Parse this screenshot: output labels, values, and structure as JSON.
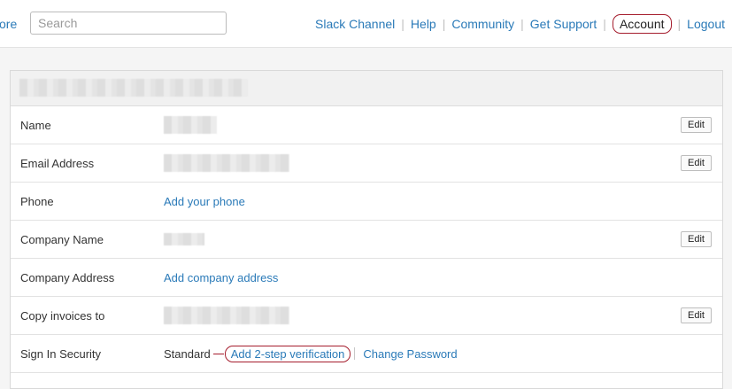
{
  "topbar": {
    "store_label": "ore",
    "search": {
      "placeholder": "Search",
      "value": ""
    },
    "nav": {
      "slack": "Slack Channel",
      "help": "Help",
      "community": "Community",
      "support": "Get Support",
      "account": "Account",
      "logout": "Logout"
    }
  },
  "profile": {
    "rows": {
      "name": {
        "label": "Name",
        "edit": "Edit"
      },
      "email": {
        "label": "Email Address",
        "edit": "Edit"
      },
      "phone": {
        "label": "Phone",
        "link": "Add your phone"
      },
      "company": {
        "label": "Company Name",
        "edit": "Edit"
      },
      "address": {
        "label": "Company Address",
        "link": "Add company address"
      },
      "invoices": {
        "label": "Copy invoices to",
        "edit": "Edit"
      },
      "security": {
        "label": "Sign In Security",
        "status": "Standard",
        "two_step": "Add 2-step verification",
        "change_password": "Change Password"
      }
    }
  },
  "colors": {
    "link": "#2a7ab8",
    "annotation": "#a51d2d"
  }
}
